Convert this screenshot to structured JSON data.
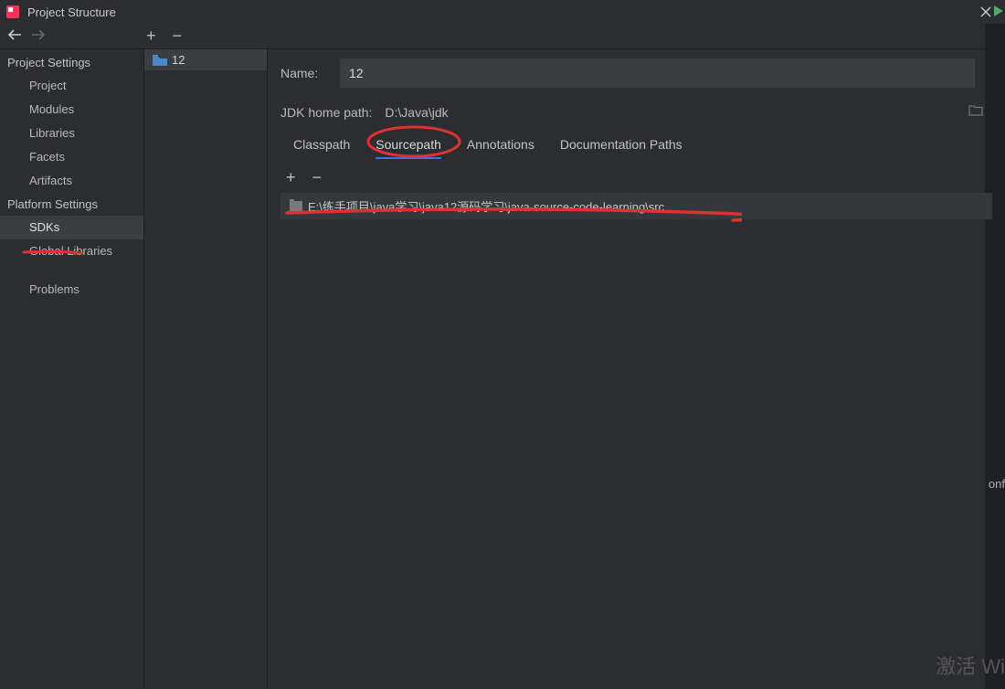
{
  "titlebar": {
    "title": "Project Structure"
  },
  "leftPanel": {
    "projectSettingsHeader": "Project Settings",
    "projectItems": [
      "Project",
      "Modules",
      "Libraries",
      "Facets",
      "Artifacts"
    ],
    "platformSettingsHeader": "Platform Settings",
    "platformItems": [
      "SDKs",
      "Global Libraries"
    ],
    "problemsItem": "Problems",
    "selected": "SDKs"
  },
  "midPanel": {
    "sdkName": "12"
  },
  "rightPanel": {
    "nameLabel": "Name:",
    "nameValue": "12",
    "homeLabel": "JDK home path:",
    "homeValue": "D:\\Java\\jdk",
    "tabs": [
      "Classpath",
      "Sourcepath",
      "Annotations",
      "Documentation Paths"
    ],
    "activeTab": "Sourcepath",
    "sourcePaths": [
      "E:\\练手项目\\java学习\\java12源码学习\\java-source-code-learning\\src"
    ]
  },
  "watermark": "激活 Wi",
  "sideText": "onf"
}
